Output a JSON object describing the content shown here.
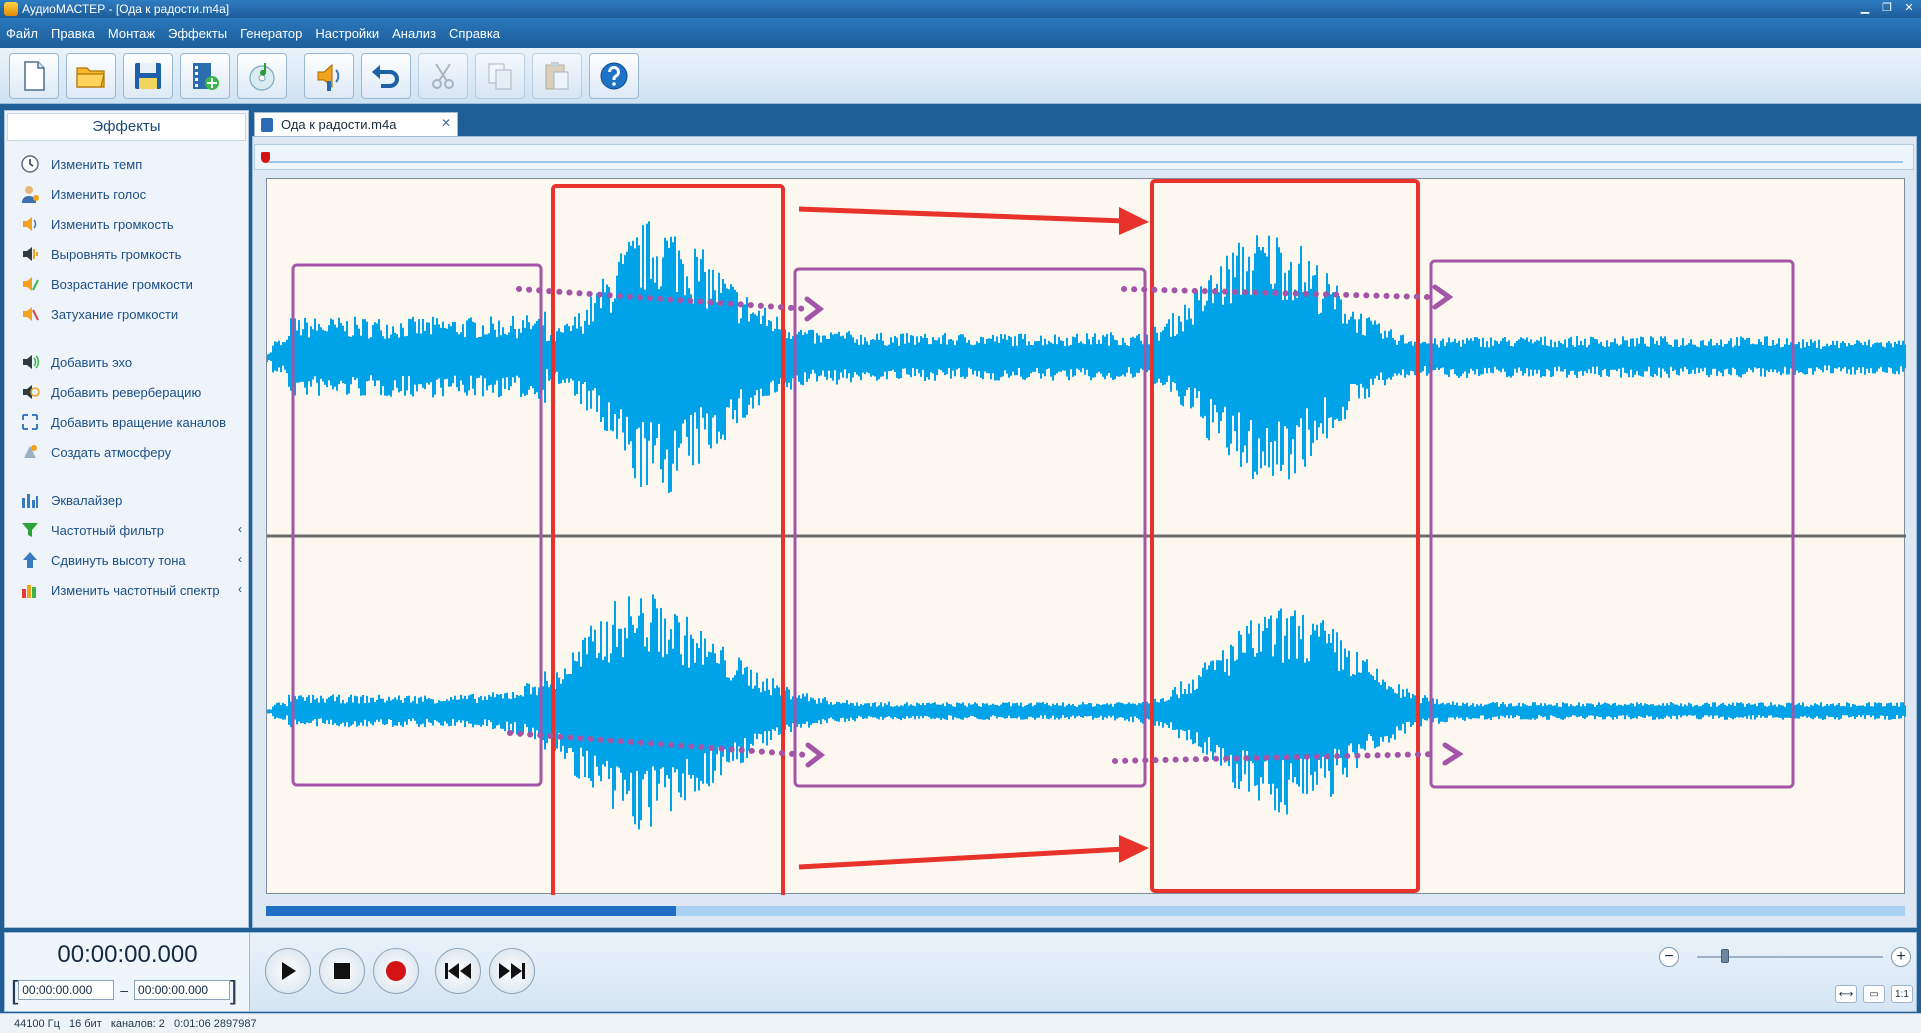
{
  "window": {
    "title": "АудиоМАСТЕР - [Ода к радости.m4a]",
    "controls": [
      "minimize",
      "restore",
      "close"
    ]
  },
  "menu": [
    "Файл",
    "Правка",
    "Монтаж",
    "Эффекты",
    "Генератор",
    "Настройки",
    "Анализ",
    "Справка"
  ],
  "toolbar": {
    "buttons": [
      {
        "icon": "new-file-icon"
      },
      {
        "icon": "open-folder-icon"
      },
      {
        "icon": "save-icon"
      },
      {
        "icon": "add-video-icon"
      },
      {
        "icon": "cd-music-icon"
      },
      {
        "icon": "audio-properties-icon"
      },
      {
        "icon": "undo-icon"
      },
      {
        "icon": "cut-icon",
        "disabled": true
      },
      {
        "icon": "copy-icon",
        "disabled": true
      },
      {
        "icon": "paste-icon",
        "disabled": true
      },
      {
        "icon": "help-icon"
      }
    ]
  },
  "sidebar": {
    "title": "Эффекты",
    "groups": [
      [
        {
          "label": "Изменить темп",
          "icon": "clock-icon"
        },
        {
          "label": "Изменить голос",
          "icon": "voice-person-icon"
        },
        {
          "label": "Изменить громкость",
          "icon": "volume-icon"
        },
        {
          "label": "Выровнять громкость",
          "icon": "volume-level-icon"
        },
        {
          "label": "Возрастание громкости",
          "icon": "fade-in-icon"
        },
        {
          "label": "Затухание громкости",
          "icon": "fade-out-icon"
        }
      ],
      [
        {
          "label": "Добавить эхо",
          "icon": "echo-icon"
        },
        {
          "label": "Добавить реверберацию",
          "icon": "reverb-icon"
        },
        {
          "label": "Добавить вращение каналов",
          "icon": "channel-rotation-icon"
        },
        {
          "label": "Создать атмосферу",
          "icon": "atmosphere-icon"
        }
      ],
      [
        {
          "label": "Эквалайзер",
          "icon": "equalizer-icon",
          "chevron": ""
        },
        {
          "label": "Частотный фильтр",
          "icon": "filter-funnel-icon",
          "chevron": "‹"
        },
        {
          "label": "Сдвинуть высоту тона",
          "icon": "pitch-arrow-icon",
          "chevron": "‹"
        },
        {
          "label": "Изменить частотный спектр",
          "icon": "spectrum-icon",
          "chevron": "‹"
        }
      ]
    ]
  },
  "editor": {
    "tab_label": "Ода к радости.m4a",
    "scroll_position": 0.25
  },
  "transport": {
    "current_time": "00:00:00.000",
    "range_start": "00:00:00.000",
    "range_end": "00:00:00.000",
    "range_dash": "–",
    "buttons": [
      "play-icon",
      "stop-icon",
      "record-icon",
      "rewind-icon",
      "fast-forward-icon"
    ],
    "zoom_out": "−",
    "zoom_in": "+",
    "view_buttons": [
      "⟷",
      "▭",
      "1:1"
    ]
  },
  "status": {
    "sample_rate": "44100 Гц",
    "bit_depth": "16 бит",
    "channels": "каналов: 2",
    "duration": "0:01:06 2897987"
  },
  "colors": {
    "wave": "#00a3e8",
    "highlight_loud": "#e8322c",
    "highlight_quiet": "#a355a8",
    "canvas_bg": "#fdf8ef"
  }
}
